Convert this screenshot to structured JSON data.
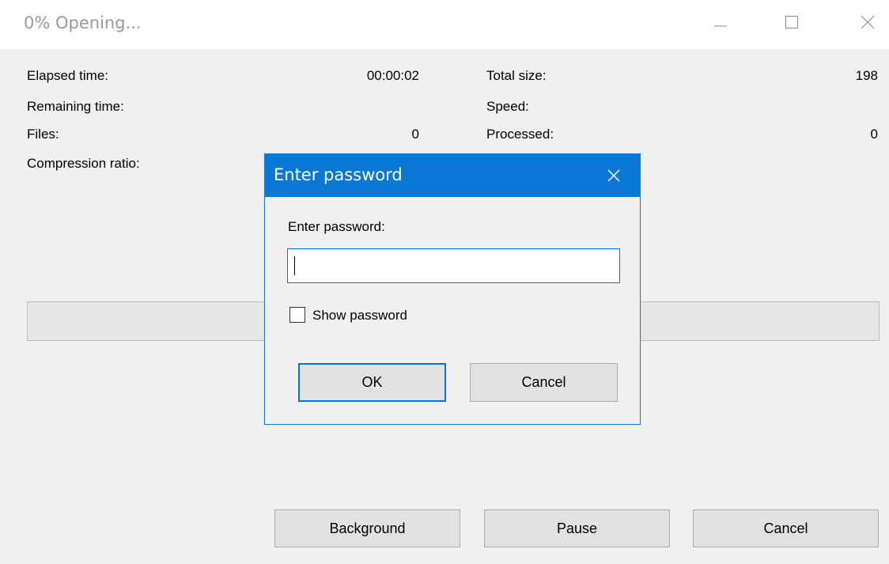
{
  "window": {
    "title": "0% Opening...",
    "controls": {
      "minimize": "minimize-icon",
      "maximize": "maximize-icon",
      "close": "close-icon"
    }
  },
  "stats": {
    "elapsed_label": "Elapsed time:",
    "elapsed_value": "00:00:02",
    "remaining_label": "Remaining time:",
    "files_label": "Files:",
    "files_value": "0",
    "ratio_label": "Compression ratio:",
    "total_label": "Total size:",
    "total_value": "198",
    "speed_label": "Speed:",
    "processed_label": "Processed:",
    "processed_value": "0"
  },
  "progress": {
    "value": 0
  },
  "buttons": {
    "background": "Background",
    "pause": "Pause",
    "cancel": "Cancel"
  },
  "dialog": {
    "title": "Enter password",
    "prompt": "Enter password:",
    "password_value": "",
    "show_password_label": "Show password",
    "show_password_checked": false,
    "ok": "OK",
    "cancel": "Cancel"
  },
  "colors": {
    "dialog_title_bg": "#0c78d6",
    "focus_border": "#0a73d0",
    "client_bg": "#f0f0f0"
  }
}
